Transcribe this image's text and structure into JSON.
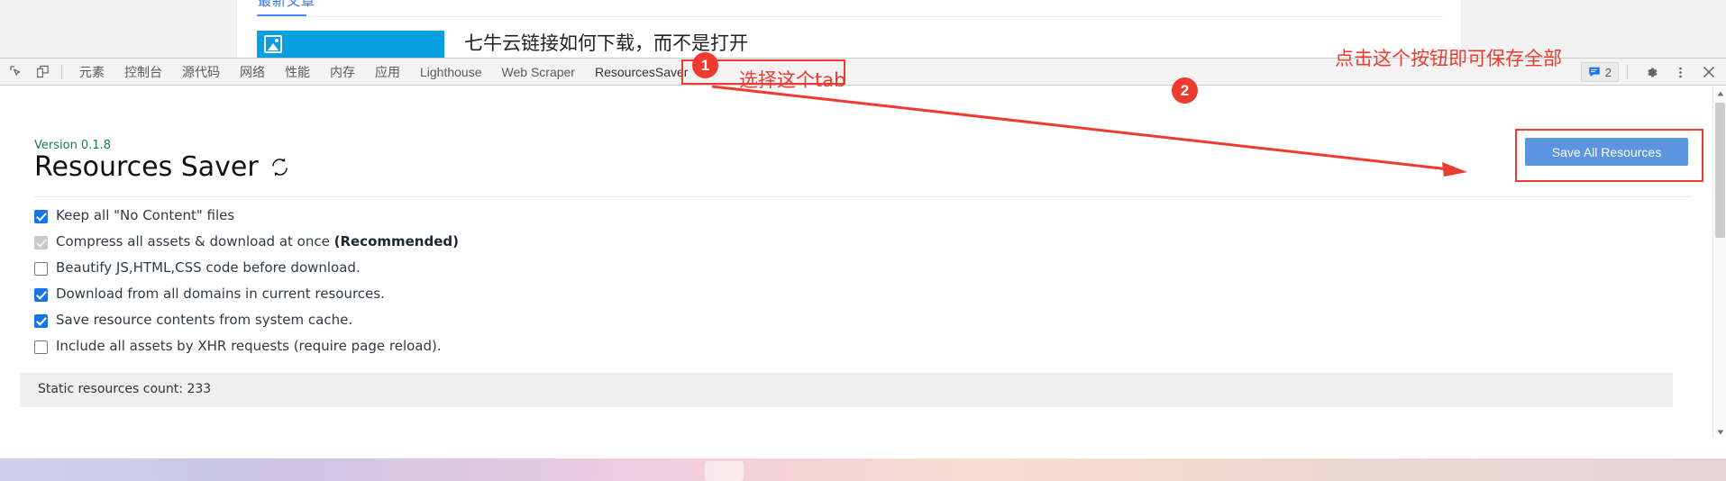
{
  "page": {
    "tab_label": "最新文章",
    "headline": "七牛云链接如何下载，而不是打开",
    "thumb_icon": "image-placeholder-icon"
  },
  "devtools": {
    "left_icons": [
      {
        "name": "inspect-element-icon",
        "glyph": "inspect"
      },
      {
        "name": "device-toolbar-icon",
        "glyph": "device"
      }
    ],
    "tabs": [
      {
        "label": "元素",
        "selected": false
      },
      {
        "label": "控制台",
        "selected": false
      },
      {
        "label": "源代码",
        "selected": false
      },
      {
        "label": "网络",
        "selected": false
      },
      {
        "label": "性能",
        "selected": false
      },
      {
        "label": "内存",
        "selected": false
      },
      {
        "label": "应用",
        "selected": false
      },
      {
        "label": "Lighthouse",
        "selected": false
      },
      {
        "label": "Web Scraper",
        "selected": false
      },
      {
        "label": "ResourcesSaver",
        "selected": true
      }
    ],
    "messages": {
      "count": "2",
      "icon": "message-icon"
    },
    "settings_icon": "gear-icon",
    "more_icon": "kebab-menu-icon",
    "close_icon": "close-icon"
  },
  "panel": {
    "version": "Version 0.1.8",
    "title": "Resources Saver",
    "refresh_icon": "refresh-icon",
    "options": [
      {
        "label": "Keep all \"No Content\" files",
        "state": "checked"
      },
      {
        "label": "Compress all assets & download at once ",
        "bold": "(Recommended)",
        "state": "checked-disabled"
      },
      {
        "label": "Beautify JS,HTML,CSS code before download.",
        "state": "unchecked"
      },
      {
        "label": "Download from all domains in current resources.",
        "state": "checked"
      },
      {
        "label": "Save resource contents from system cache.",
        "state": "checked"
      },
      {
        "label": "Include all assets by XHR requests (require page reload).",
        "state": "unchecked"
      }
    ],
    "status": "Static resources count: 233",
    "save_button": "Save All Resources"
  },
  "annotations": {
    "badge_one": "1",
    "badge_two": "2",
    "note_tab": "选择这个tab",
    "note_button": "点击这个按钮即可保存全部",
    "accent_color": "#ee3b2f"
  }
}
